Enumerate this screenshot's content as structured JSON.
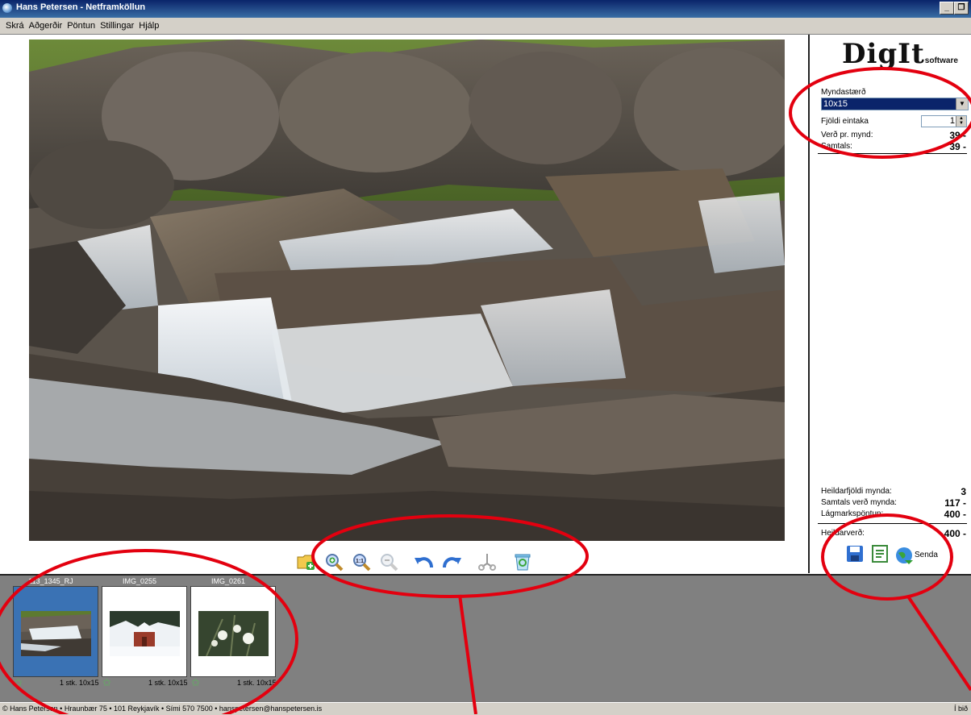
{
  "window": {
    "title": "Hans Petersen - Netframköllun",
    "minimize_label": "_",
    "restore_label": "❐"
  },
  "menu": [
    "Skrá",
    "Aðgerðir",
    "Pöntun",
    "Stillingar",
    "Hjálp"
  ],
  "logo": {
    "name": "DigIt",
    "suffix": "software"
  },
  "order_panel": {
    "size_label": "Myndastærð",
    "size_value": "10x15",
    "copies_label": "Fjöldi eintaka",
    "copies_value": "1",
    "price_per_label": "Verð pr. mynd:",
    "price_per_value": "39 -",
    "total_label": "Samtals:",
    "total_value": "39 -"
  },
  "summary": {
    "count_label": "Heildarfjöldi mynda:",
    "count_value": "3",
    "photos_total_label": "Samtals verð mynda:",
    "photos_total_value": "117 -",
    "minimum_label": "Lágmarkspöntun:",
    "minimum_value": "400 -",
    "grand_total_label": "Heildarverð:",
    "grand_total_value": "400 -"
  },
  "actions": {
    "send_label": "Senda"
  },
  "toolbar_icons": [
    "add-folder-icon",
    "zoom-in-icon",
    "zoom-actual-icon",
    "zoom-out-icon",
    "rotate-left-icon",
    "rotate-right-icon",
    "crop-scissors-icon",
    "recycle-bin-icon"
  ],
  "thumbnails": [
    {
      "name": "113_1345_RJ",
      "info": "1 stk. 10x15",
      "selected": true
    },
    {
      "name": "IMG_0255",
      "info": "1 stk. 10x15",
      "selected": false
    },
    {
      "name": "IMG_0261",
      "info": "1 stk. 10x15",
      "selected": false
    }
  ],
  "status": {
    "left": "© Hans Petersen • Hraunbær 75 • 101 Reykjavík • Sími 570 7500 • hanspetersen@hanspetersen.is",
    "right": "Í bið"
  },
  "colors": {
    "selection": "#0a246a",
    "strip": "#808080",
    "annotation": "#e3000f",
    "thumb_selected": "#3a72b4"
  }
}
